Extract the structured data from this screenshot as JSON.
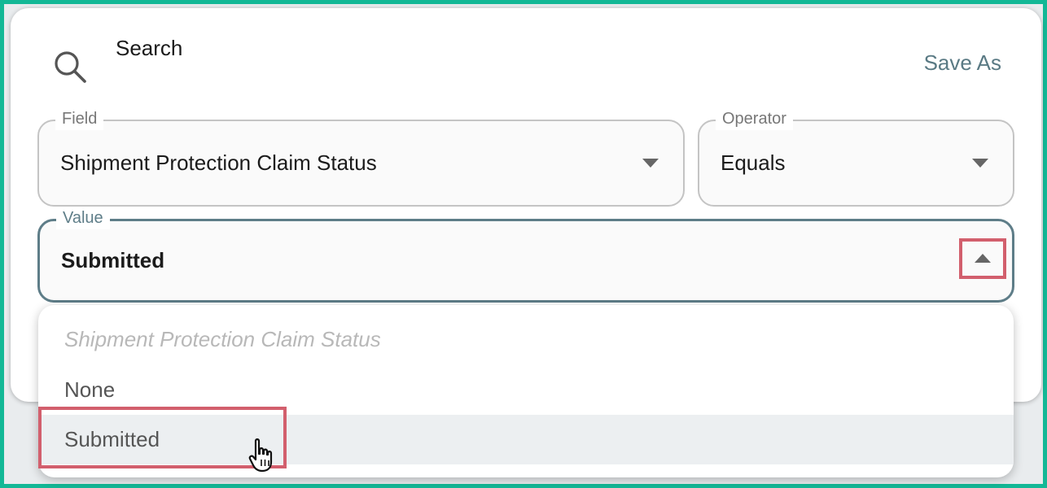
{
  "dialog": {
    "title": "Search",
    "save_as": "Save As"
  },
  "field": {
    "label": "Field",
    "value": "Shipment Protection Claim Status"
  },
  "operator": {
    "label": "Operator",
    "value": "Equals"
  },
  "value_field": {
    "label": "Value",
    "value": "Submitted"
  },
  "dropdown": {
    "header": "Shipment Protection Claim Status",
    "options": [
      {
        "label": "None",
        "selected": false
      },
      {
        "label": "Submitted",
        "selected": true
      }
    ]
  },
  "icons": {
    "search": "search-icon",
    "field_arrow": "chevron-down-icon",
    "operator_arrow": "chevron-down-icon",
    "value_arrow": "chevron-up-icon",
    "cursor": "hand-pointer-icon"
  },
  "colors": {
    "frame_border": "#13b896",
    "accent": "#5e7d88",
    "highlight": "#d25f6d",
    "selected_bg": "#eceff1"
  }
}
